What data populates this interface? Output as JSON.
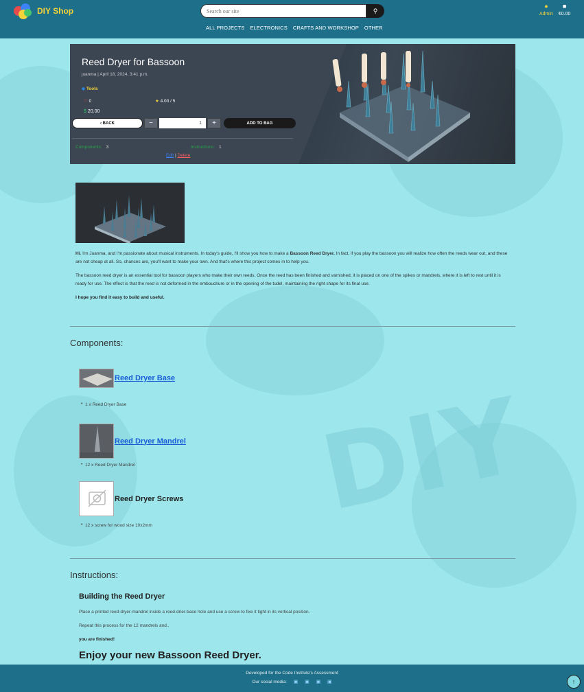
{
  "header": {
    "brand": "DIY Shop",
    "search_placeholder": "Search our site",
    "search_icon": "search-icon",
    "nav": [
      "ALL PROJECTS",
      "ELECTRONICS",
      "CRAFTS AND WORKSHOP",
      "OTHER"
    ],
    "account_label": "Admin",
    "bag_total": "€0.00",
    "brand_color": "#f3d23a",
    "bar_color": "#1e6f89"
  },
  "project": {
    "title": "Reed Dryer for Bassoon",
    "meta": "juanma | April 18, 2024, 3:41 p.m.",
    "tag": "Tools",
    "likes": "0",
    "rating": "4.00 / 5",
    "price": "20.00",
    "back_label": "BACK",
    "qty_minus": "−",
    "qty_value": "1",
    "qty_plus": "+",
    "add_label": "ADD TO BAG",
    "components_label": "Components:",
    "components_count": "3",
    "instructions_label": "Instructions:",
    "instructions_count": "1",
    "edit_label": "Edit",
    "sep_char": "|",
    "delete_label": "Delete"
  },
  "description": {
    "hi": "Hi",
    "p1_a": ", I'm Juanma, and I'm passionate about musical instruments. In today's guide, I'll show you how to make a ",
    "p1_b": "Bassoon Reed Dryer.",
    "p1_c": " In fact, if you play the bassoon you will realize how often the reeds wear out, and these are not cheap at all. So, chances are, you'll want to make your own. And that's where this project comes in to help you.",
    "p2": "The bassoon reed dryer is an essential tool for bassoon players who make their own reeds. Once the reed has been finished and varnished, it is placed on one of the spikes or mandrels, where it is left to rest until it is ready for use. The effect is that the reed is not deformed in the embouchure or in the opening of the tudel, maintaining the right shape for its final use.",
    "p3": "I hope you find it easy to build and useful."
  },
  "components": {
    "heading": "Components:",
    "items": [
      {
        "name": "Reed Dryer Base",
        "detail": "1 x Reed Dryer Base"
      },
      {
        "name": "Reed Dryer Mandrel",
        "detail": "12 x Reed Dryer Mandrel"
      },
      {
        "name": "Reed Dryer Screws",
        "detail": "12 x screw for wood size 10x2mm"
      }
    ]
  },
  "instructions": {
    "heading": "Instructions:",
    "step_title": "Building the Reed Dryer",
    "step_1": "Place a printed reed-dryer-mandrel inside a reed-drier-base hole and use a screw to fixe it tight in its vertical position.",
    "step_2": "Repeat this process for the 12 mandrels and..",
    "step_3": "you are finished!",
    "closing": "Enjoy your new Bassoon Reed Dryer."
  },
  "footer": {
    "line1": "Developed for the Code Institute's Assessment",
    "social_label": "Our social media:",
    "social_icons": [
      "facebook-icon",
      "twitter-icon",
      "email-icon",
      "youtube-icon"
    ]
  },
  "watermark": {
    "text": "DIY"
  }
}
